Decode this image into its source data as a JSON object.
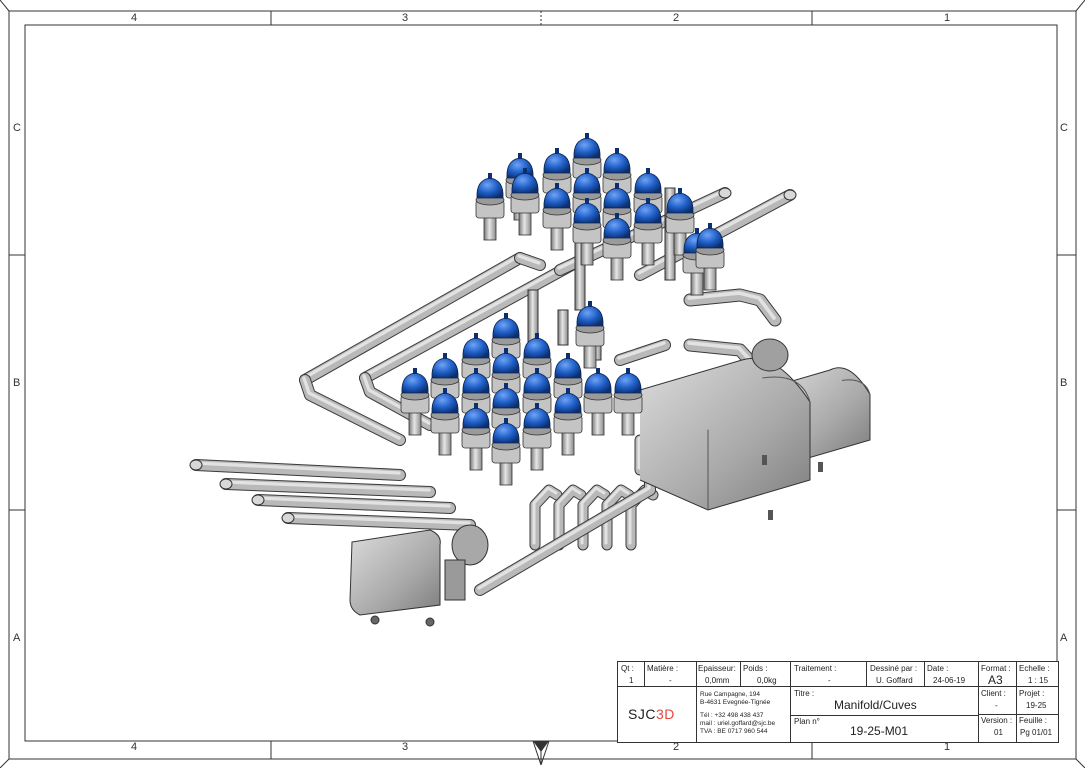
{
  "sheet": {
    "zones_columns": [
      "4",
      "3",
      "2",
      "1"
    ],
    "zones_rows": [
      "C",
      "B",
      "A"
    ]
  },
  "drawing": {
    "subject": "isometric manifold with valves, pipes and tanks",
    "colors": {
      "valve_blue": "#1f5fc7",
      "steel": "#b9b9b9",
      "steel_dark": "#7a7a7a",
      "steel_light": "#e2e2e2"
    }
  },
  "title_block": {
    "qt_label": "Qt :",
    "qt_value": "1",
    "matiere_label": "Matière :",
    "matiere_value": "-",
    "epaisseur_label": "Epaisseur:",
    "epaisseur_value": "0,0mm",
    "poids_label": "Poids :",
    "poids_value": "0,0kg",
    "traitement_label": "Traitement :",
    "traitement_value": "-",
    "dessine_label": "Dessiné par :",
    "dessine_value": "U. Goffard",
    "date_label": "Date :",
    "date_value": "24-06-19",
    "format_label": "Format :",
    "format_value": "A3",
    "echelle_label": "Echelle :",
    "echelle_value": "1 : 15",
    "logo_left": "SJC",
    "logo_right": "3D",
    "address_line1": "Rue Campagne, 194",
    "address_line2": "B-4631 Evegnée-Tignée",
    "address_line3": "Tél : +32 498 438 437",
    "address_line4": "mail : uriel.goffard@sjc.be",
    "address_line5": "TVA : BE 0717 960 544",
    "titre_label": "Titre :",
    "titre_value": "Manifold/Cuves",
    "plan_label": "Plan n°",
    "plan_value": "19-25-M01",
    "client_label": "Client :",
    "client_value": "-",
    "projet_label": "Projet :",
    "projet_value": "19-25",
    "version_label": "Version :",
    "version_value": "01",
    "feuille_label": "Feuille :",
    "feuille_value": "Pg 01/01"
  }
}
